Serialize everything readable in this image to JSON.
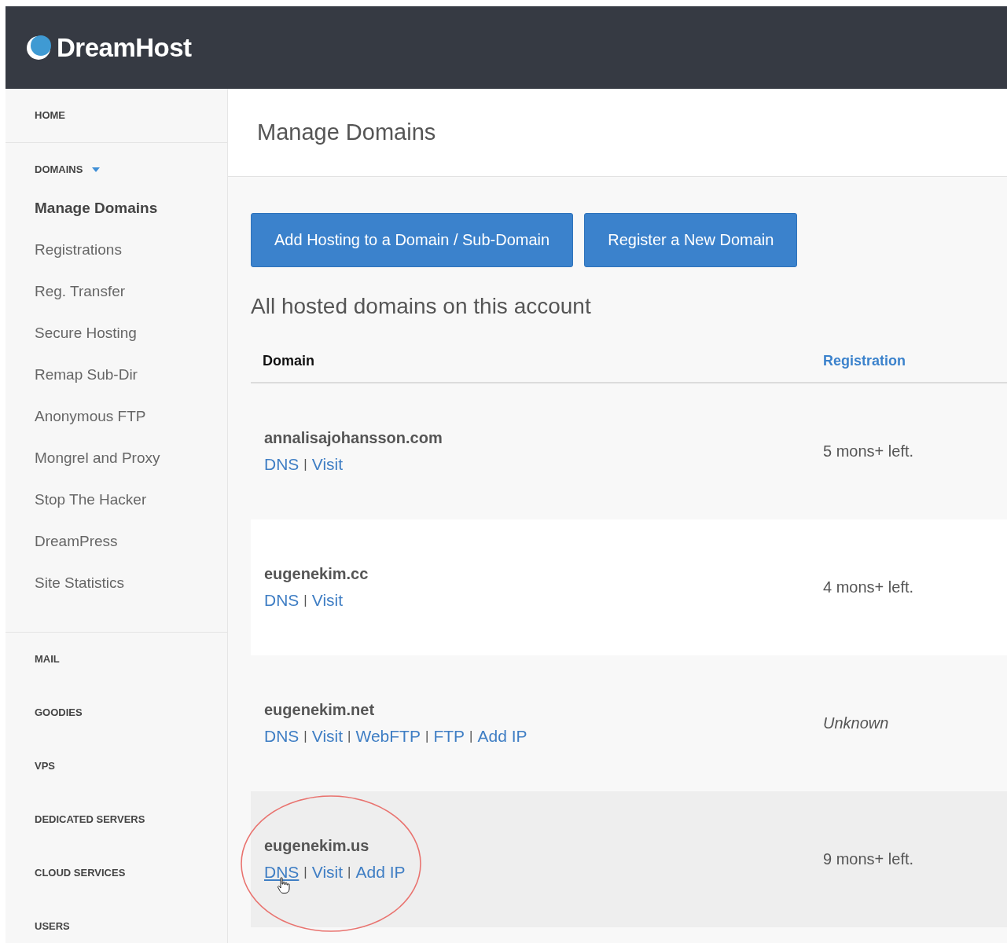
{
  "brand": {
    "name": "DreamHost"
  },
  "sidebar": {
    "sections": [
      {
        "label": "HOME",
        "expanded": false
      },
      {
        "label": "DOMAINS",
        "expanded": true,
        "items": [
          {
            "label": "Manage Domains",
            "selected": true
          },
          {
            "label": "Registrations",
            "selected": false
          },
          {
            "label": "Reg. Transfer",
            "selected": false
          },
          {
            "label": "Secure Hosting",
            "selected": false
          },
          {
            "label": "Remap Sub-Dir",
            "selected": false
          },
          {
            "label": "Anonymous FTP",
            "selected": false
          },
          {
            "label": "Mongrel and Proxy",
            "selected": false
          },
          {
            "label": "Stop The Hacker",
            "selected": false
          },
          {
            "label": "DreamPress",
            "selected": false
          },
          {
            "label": "Site Statistics",
            "selected": false
          }
        ]
      },
      {
        "label": "MAIL",
        "expanded": false
      },
      {
        "label": "GOODIES",
        "expanded": false
      },
      {
        "label": "VPS",
        "expanded": false
      },
      {
        "label": "DEDICATED SERVERS",
        "expanded": false
      },
      {
        "label": "CLOUD SERVICES",
        "expanded": false
      },
      {
        "label": "USERS",
        "expanded": false
      }
    ]
  },
  "page_title": "Manage Domains",
  "buttons": [
    "Add Hosting to a Domain / Sub-Domain",
    "Register a New Domain"
  ],
  "subtitle": "All hosted domains on this account",
  "table": {
    "link_separator": "|",
    "columns": [
      {
        "label": "Domain",
        "kind": "plain"
      },
      {
        "label": "Registration",
        "kind": "link"
      }
    ],
    "rows": [
      {
        "domain": "annalisajohansson.com",
        "links": [
          {
            "label": "DNS",
            "hovered": false
          },
          {
            "label": "Visit",
            "hovered": false
          }
        ],
        "registration": "5 mons+ left.",
        "registration_known": true,
        "highlighted": false,
        "circled": false
      },
      {
        "domain": "eugenekim.cc",
        "links": [
          {
            "label": "DNS",
            "hovered": false
          },
          {
            "label": "Visit",
            "hovered": false
          }
        ],
        "registration": "4 mons+ left.",
        "registration_known": true,
        "highlighted": false,
        "circled": false
      },
      {
        "domain": "eugenekim.net",
        "links": [
          {
            "label": "DNS",
            "hovered": false
          },
          {
            "label": "Visit",
            "hovered": false
          },
          {
            "label": "WebFTP",
            "hovered": false
          },
          {
            "label": "FTP",
            "hovered": false
          },
          {
            "label": "Add IP",
            "hovered": false
          }
        ],
        "registration": "Unknown",
        "registration_known": false,
        "highlighted": false,
        "circled": false
      },
      {
        "domain": "eugenekim.us",
        "links": [
          {
            "label": "DNS",
            "hovered": true
          },
          {
            "label": "Visit",
            "hovered": false
          },
          {
            "label": "Add IP",
            "hovered": false
          }
        ],
        "registration": "9 mons+ left.",
        "registration_known": true,
        "highlighted": true,
        "circled": true
      }
    ]
  }
}
